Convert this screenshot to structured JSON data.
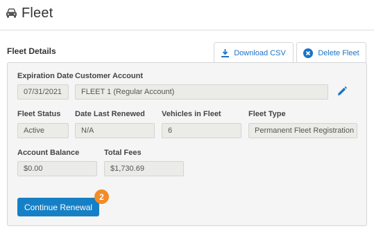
{
  "header": {
    "title": "Fleet",
    "icon": "car-icon"
  },
  "section": {
    "title": "Fleet Details"
  },
  "actions": {
    "download_csv": "Download CSV",
    "delete_fleet": "Delete Fleet"
  },
  "fields": {
    "expiration_date": {
      "label": "Expiration Date",
      "value": "07/31/2021"
    },
    "customer_account": {
      "label": "Customer Account",
      "value": "FLEET 1 (Regular Account)"
    },
    "fleet_status": {
      "label": "Fleet Status",
      "value": "Active"
    },
    "date_last_renewed": {
      "label": "Date Last Renewed",
      "value": "N/A"
    },
    "vehicles_in_fleet": {
      "label": "Vehicles in Fleet",
      "value": "6"
    },
    "fleet_type": {
      "label": "Fleet Type",
      "value": "Permanent Fleet Registration"
    },
    "account_balance": {
      "label": "Account Balance",
      "value": "$0.00"
    },
    "total_fees": {
      "label": "Total Fees",
      "value": "$1,730.69"
    }
  },
  "continue_renewal": "Continue Renewal",
  "step_badge": "2",
  "colors": {
    "accent": "#1580c6",
    "link": "#1a73c8",
    "badge": "#f28c28"
  }
}
